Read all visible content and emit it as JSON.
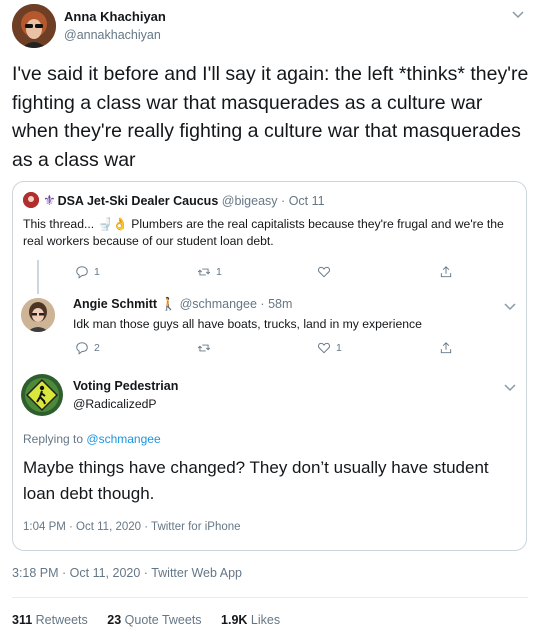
{
  "author": {
    "name": "Anna Khachiyan",
    "handle": "@annakhachiyan"
  },
  "tweet_text": "I've said it before and I'll say it again: the left *thinks* they're fighting a class war that masquerades as a culture war when they're really fighting a culture war that masquerades as a class war",
  "quote": {
    "name": "DSA Jet-Ski Dealer Caucus",
    "handle": "@bigeasy",
    "separator": "·",
    "date": "Oct 11",
    "text_prefix": "This thread...",
    "text_main": "Plumbers are the real capitalists because they're frugal and we're the real workers because of our student loan debt.",
    "actions": {
      "replies": "1",
      "retweets": "1",
      "likes": ""
    }
  },
  "reply1": {
    "name": "Angie Schmitt",
    "handle": "@schmangee",
    "separator": "·",
    "time": "58m",
    "text": "Idk man those guys all have boats, trucks, land in my experience",
    "actions": {
      "replies": "2",
      "retweets": "",
      "likes": "1"
    }
  },
  "reply2": {
    "name": "Voting Pedestrian",
    "handle": "@RadicalizedP",
    "replying_to_label": "Replying to",
    "replying_to_handle": "@schmangee",
    "text": "Maybe things have changed? They don’t usually have student loan debt though.",
    "meta": "1:04 PM · Oct 11, 2020 · Twitter for iPhone"
  },
  "tweet_meta": "3:18 PM · Oct 11, 2020 · Twitter Web App",
  "stats": {
    "retweets_count": "311",
    "retweets_label": "Retweets",
    "quotes_count": "23",
    "quotes_label": "Quote Tweets",
    "likes_count": "1.9K",
    "likes_label": "Likes"
  },
  "colors": {
    "link": "#1b95e0",
    "secondary_text": "#657786",
    "border": "#ccd6dd"
  }
}
